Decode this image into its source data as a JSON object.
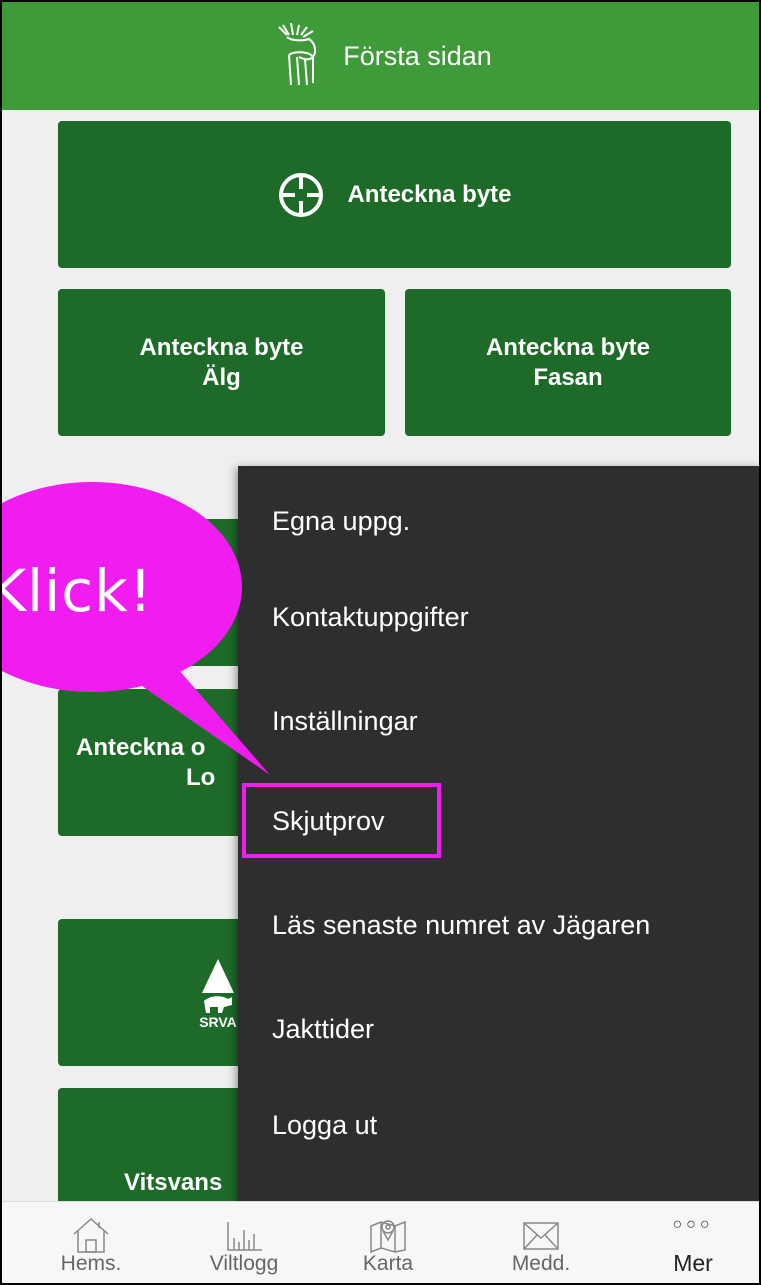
{
  "header": {
    "title": "Första sidan",
    "logo_icon": "moose-logo-icon"
  },
  "tiles": {
    "main": {
      "label": "Anteckna byte",
      "icon": "crosshair-icon"
    },
    "alg": {
      "line1": "Anteckna byte",
      "line2": "Älg"
    },
    "fasan": {
      "line1": "Anteckna byte",
      "line2": "Fasan"
    },
    "partial_1": {
      "line1": "Anteckna o",
      "line2": "Lo"
    },
    "srva": {
      "label": "SRVA",
      "icon": "srva-logo-icon"
    },
    "vits": {
      "label": "Vitsvans"
    }
  },
  "menu": {
    "items": [
      "Egna uppg.",
      "Kontaktuppgifter",
      "Inställningar",
      "Skjutprov",
      "Läs senaste numret av Jägaren",
      "Jakttider",
      "Logga ut"
    ],
    "highlighted_index": 3
  },
  "callout": {
    "text": "Klick!",
    "color": "#f01cf0"
  },
  "bottom_nav": {
    "items": [
      {
        "label": "Hems.",
        "icon": "home-icon"
      },
      {
        "label": "Viltlogg",
        "icon": "bar-chart-icon"
      },
      {
        "label": "Karta",
        "icon": "map-icon"
      },
      {
        "label": "Medd.",
        "icon": "mail-icon"
      },
      {
        "label": "Mer",
        "icon": "more-dots-icon",
        "dots": "○○○",
        "active": true
      }
    ]
  },
  "colors": {
    "header": "#3f9a3a",
    "tile": "#1e6b29",
    "menu_bg": "#2e2e2e",
    "highlight": "#f01cf0"
  }
}
